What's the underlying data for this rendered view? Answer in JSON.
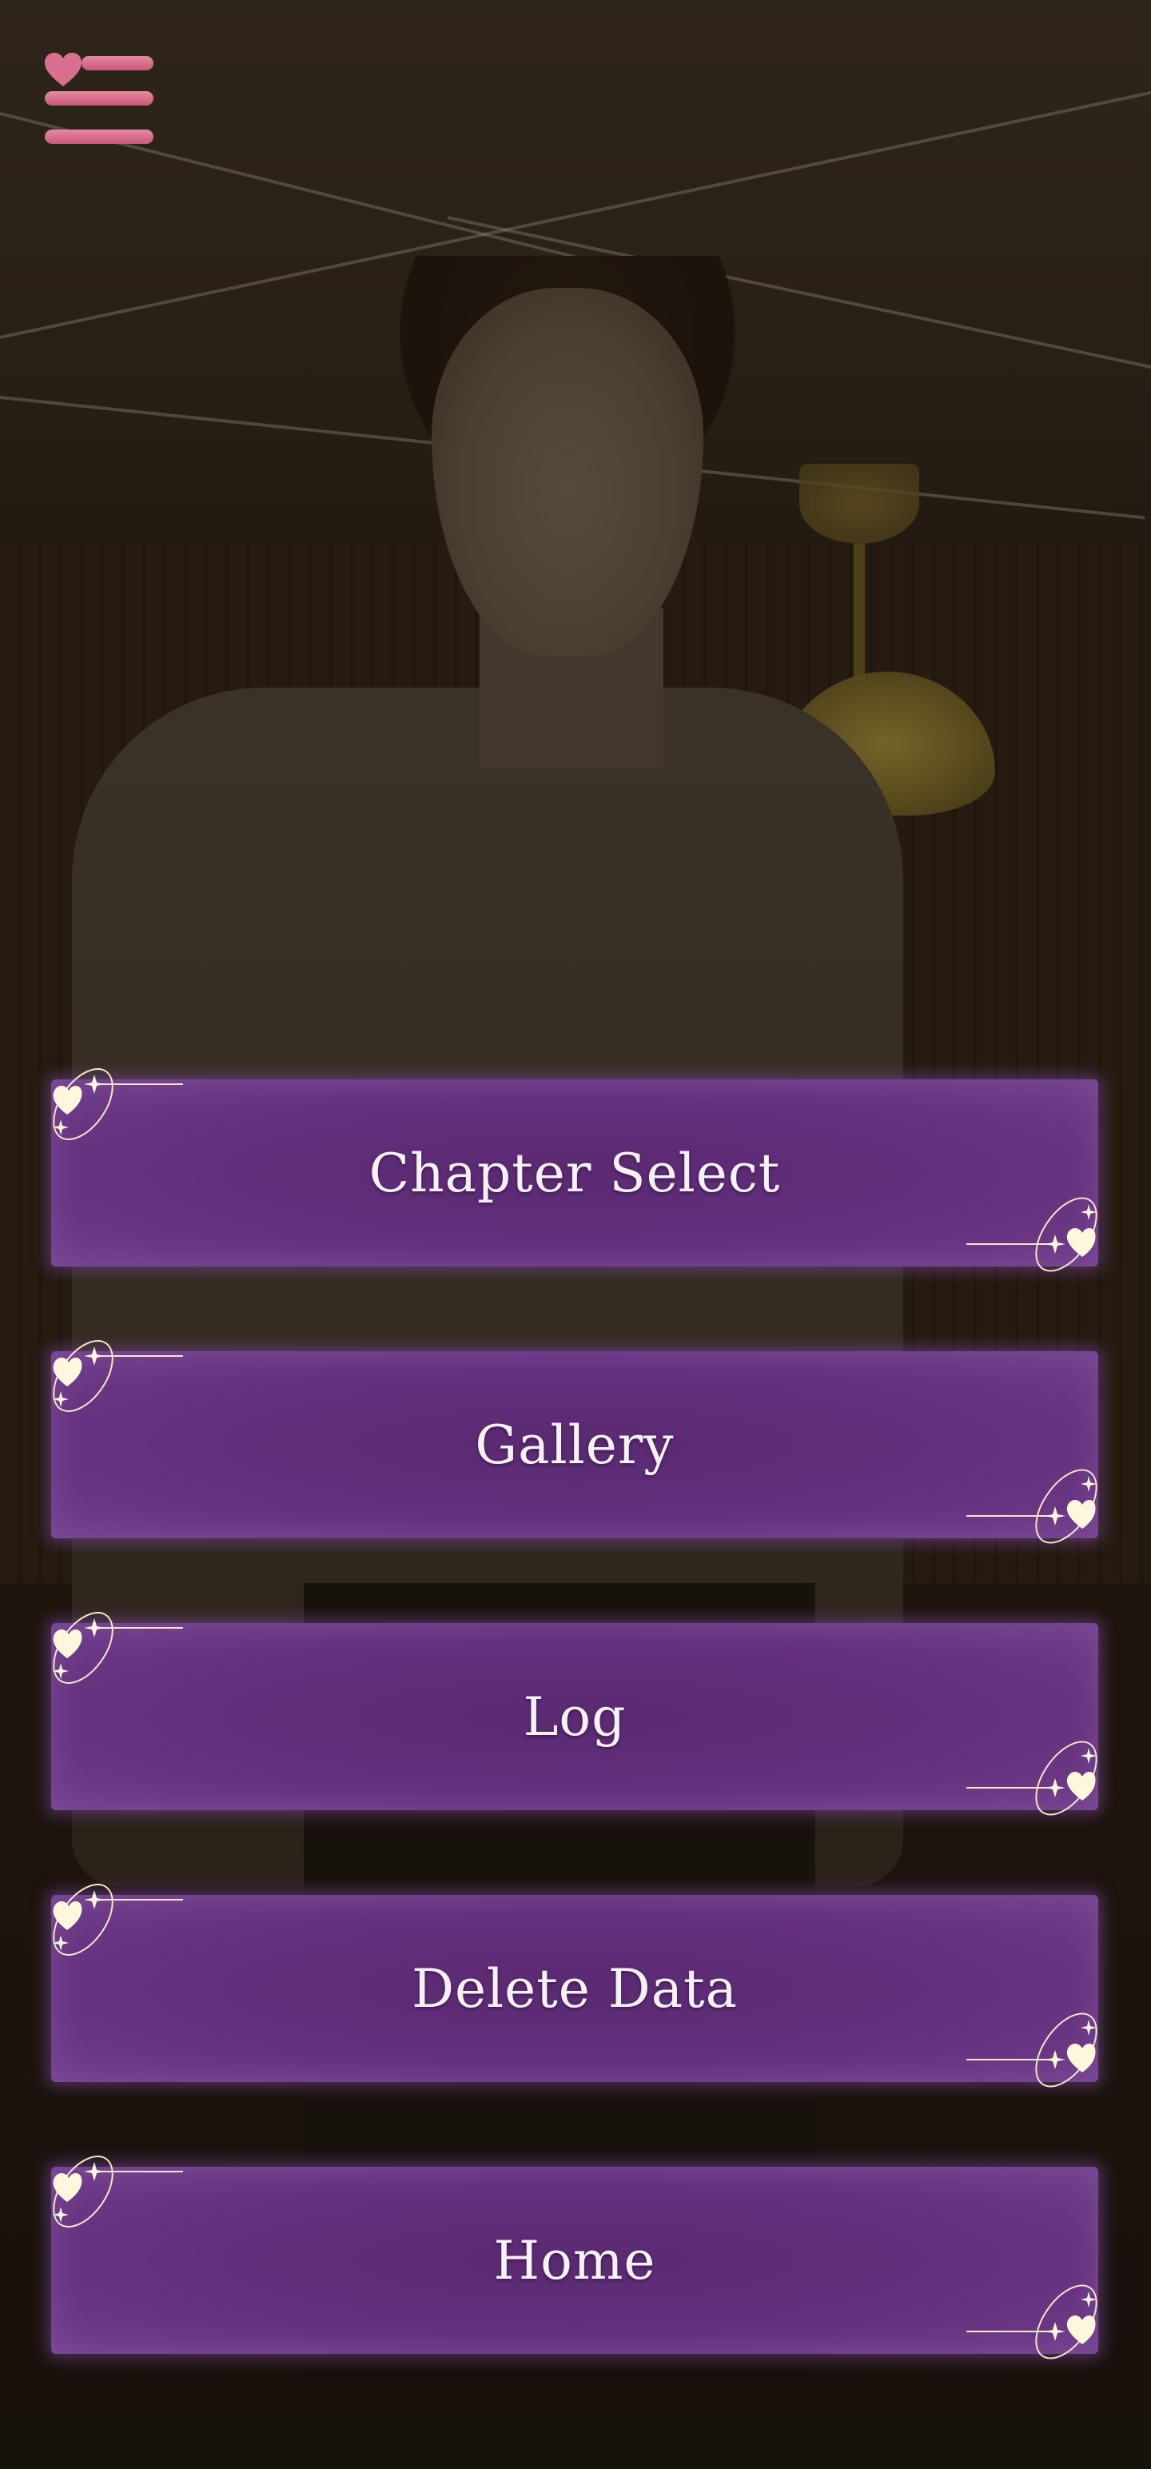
{
  "menu_button": {
    "icon": "hamburger-heart-icon",
    "color": "#d9708f"
  },
  "menu": {
    "items": [
      {
        "label": "Chapter Select"
      },
      {
        "label": "Gallery"
      },
      {
        "label": "Log"
      },
      {
        "label": "Delete Data"
      },
      {
        "label": "Home"
      }
    ],
    "decoration_icon": "heart-sparkle-icon",
    "button_color": "#5e2c76"
  }
}
